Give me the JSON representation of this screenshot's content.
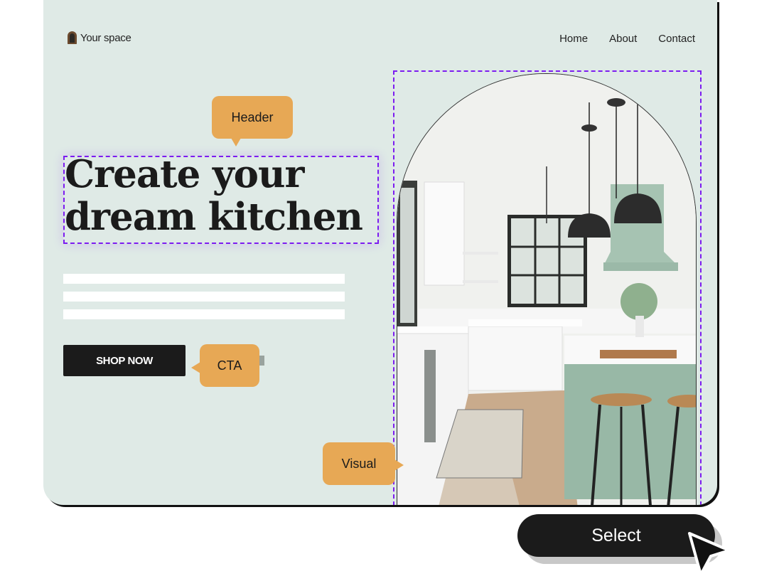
{
  "site": {
    "logo_text": "Your space",
    "nav": [
      "Home",
      "About",
      "Contact"
    ]
  },
  "hero": {
    "headline_line1": "Create your",
    "headline_line2": "dream kitchen",
    "cta_label": "SHOP NOW",
    "body_placeholder_lines": 3,
    "image_alt": "Bright kitchen with white cabinets, sage green island, black pendant lights and wooden bar stools"
  },
  "annotations": {
    "header": "Header",
    "cta": "CTA",
    "visual": "Visual"
  },
  "actions": {
    "select_label": "Select"
  },
  "colors": {
    "background": "#dfeae6",
    "accent_outline": "#7c1cf0",
    "bubble": "#e7a855",
    "dark": "#1b1b1b",
    "sage": "#9fbfae"
  }
}
